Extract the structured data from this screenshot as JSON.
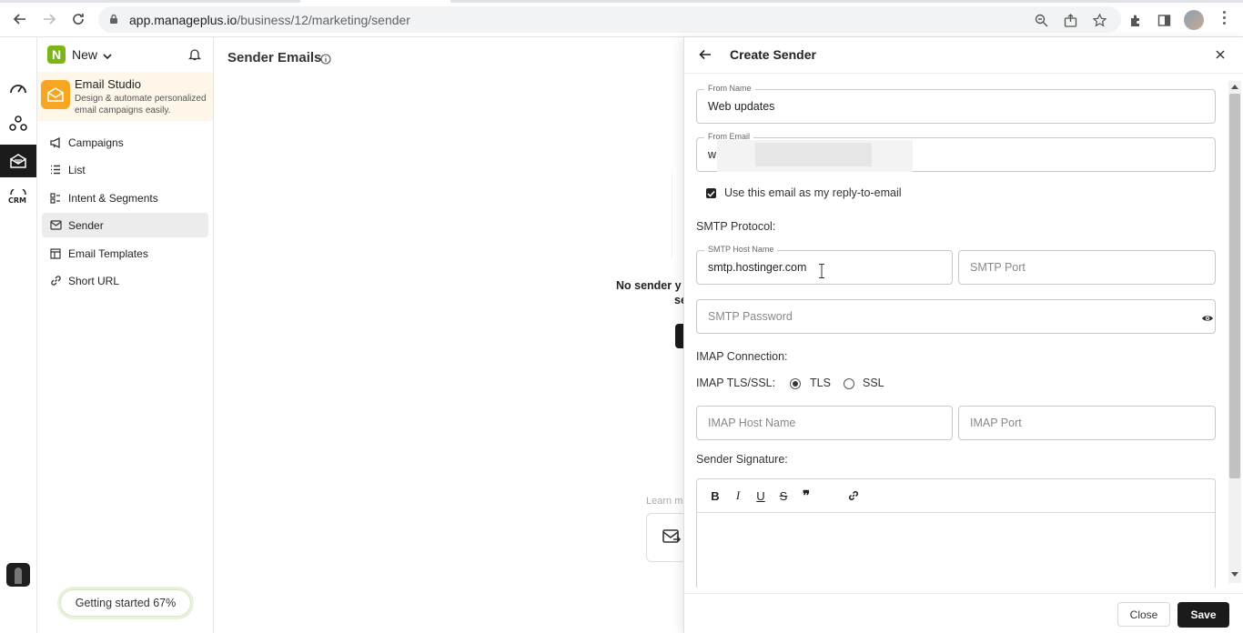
{
  "browser": {
    "url_host": "app.manageplus.io",
    "url_path": "/business/12/marketing/sender"
  },
  "sidebar": {
    "logo_letter": "N",
    "new_label": "New",
    "studio": {
      "title": "Email Studio",
      "subtitle": "Design & automate personalized email campaigns easily."
    },
    "items": [
      {
        "label": "Campaigns",
        "icon": "megaphone-icon"
      },
      {
        "label": "List",
        "icon": "list-icon"
      },
      {
        "label": "Intent & Segments",
        "icon": "segments-icon"
      },
      {
        "label": "Sender",
        "icon": "sender-mail-icon",
        "active": true
      },
      {
        "label": "Email Templates",
        "icon": "templates-icon"
      },
      {
        "label": "Short URL",
        "icon": "link-icon"
      }
    ],
    "getting_started": "Getting started  67%"
  },
  "main": {
    "title": "Sender Emails",
    "empty_line1": "No sender y",
    "empty_line2": "se",
    "learn_more": "Learn m"
  },
  "drawer": {
    "title": "Create Sender",
    "from_name": {
      "label": "From Name",
      "value": "Web updates"
    },
    "from_email": {
      "label": "From Email",
      "value": "w"
    },
    "reply_to_checkbox": {
      "label": "Use this email as my reply-to-email",
      "checked": true
    },
    "smtp_section": "SMTP Protocol:",
    "smtp_host": {
      "label": "SMTP Host Name",
      "value": "smtp.hostinger.com"
    },
    "smtp_port": {
      "placeholder": "SMTP Port"
    },
    "smtp_password": {
      "placeholder": "SMTP Password"
    },
    "imap_section": "IMAP Connection:",
    "imap_tls_label": "IMAP TLS/SSL:",
    "imap_options": [
      {
        "label": "TLS",
        "selected": true
      },
      {
        "label": "SSL",
        "selected": false
      }
    ],
    "imap_host": {
      "placeholder": "IMAP Host Name"
    },
    "imap_port": {
      "placeholder": "IMAP Port"
    },
    "signature_section": "Sender Signature:",
    "editor_toolbar": {
      "bold": "B",
      "italic": "I",
      "underline": "U",
      "strike": "S",
      "quote": "❞"
    },
    "footer": {
      "close_label": "Close",
      "save_label": "Save"
    }
  },
  "colors": {
    "brand_green": "#7cb518",
    "studio_orange": "#f5a623",
    "primary_dark": "#1b1b1b"
  }
}
